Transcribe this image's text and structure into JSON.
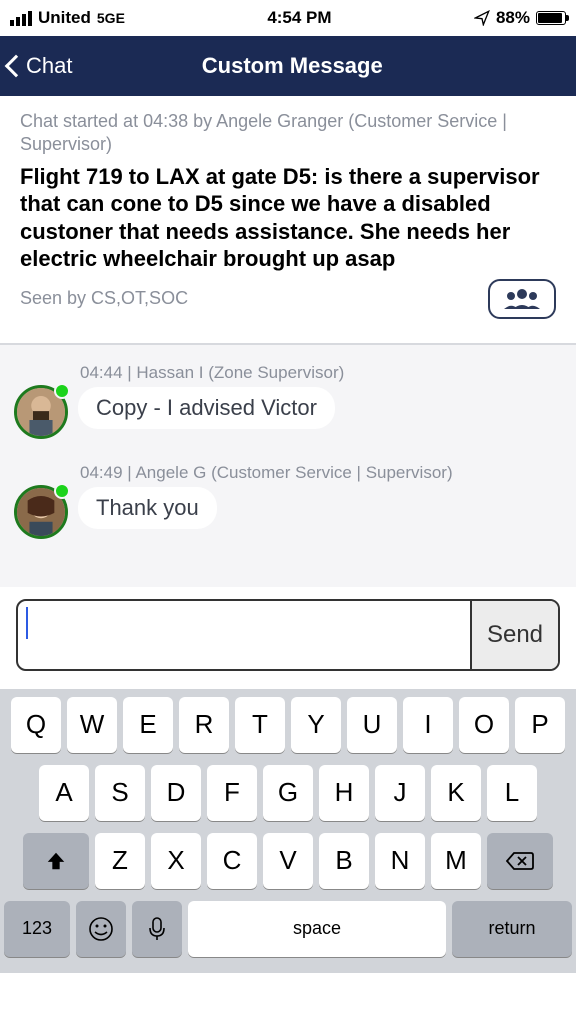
{
  "status": {
    "carrier": "United",
    "network": "5GE",
    "time": "4:54 PM",
    "battery_pct": "88%"
  },
  "nav": {
    "back_label": "Chat",
    "title": "Custom Message"
  },
  "header": {
    "started_line": "Chat started at 04:38 by Angele Granger (Customer Service | Supervisor)",
    "main_message": "Flight 719 to LAX at gate D5:  is there a supervisor that can cone to D5 since we have a disabled custoner that needs assistance. She needs her electric wheelchair brought up asap",
    "seen_by": "Seen by CS,OT,SOC"
  },
  "messages": [
    {
      "meta": "04:44 | Hassan I (Zone Supervisor)",
      "text": "Copy - I advised Victor"
    },
    {
      "meta": "04:49 | Angele G (Customer Service | Supervisor)",
      "text": "Thank you"
    }
  ],
  "input": {
    "value": "",
    "send_label": "Send"
  },
  "keyboard": {
    "row1": [
      "Q",
      "W",
      "E",
      "R",
      "T",
      "Y",
      "U",
      "I",
      "O",
      "P"
    ],
    "row2": [
      "A",
      "S",
      "D",
      "F",
      "G",
      "H",
      "J",
      "K",
      "L"
    ],
    "row3": [
      "Z",
      "X",
      "C",
      "V",
      "B",
      "N",
      "M"
    ],
    "num_label": "123",
    "space_label": "space",
    "return_label": "return"
  }
}
